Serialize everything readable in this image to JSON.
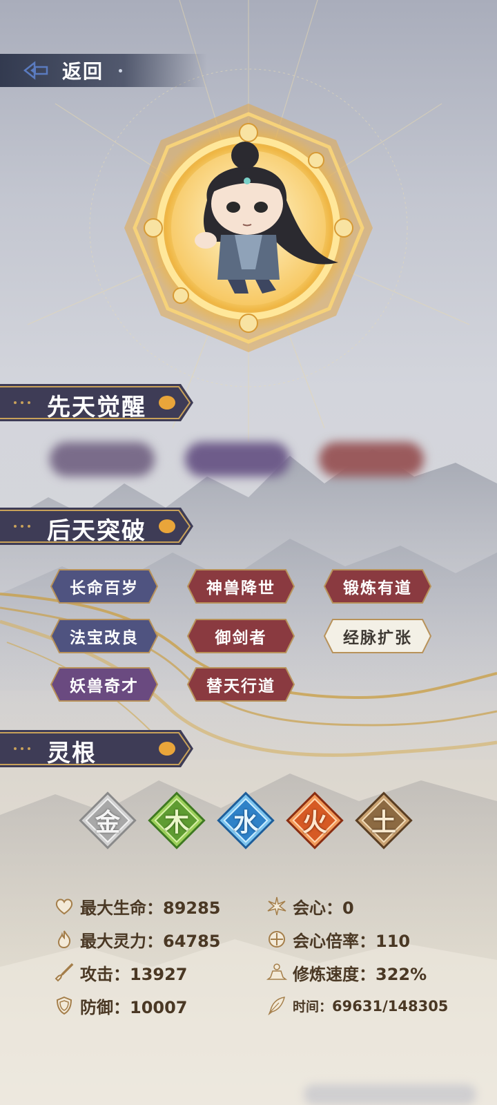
{
  "header": {
    "back_label": "返回"
  },
  "sections": {
    "innate_title": "先天觉醒",
    "acquired_title": "后天突破",
    "spirit_root_title": "灵根"
  },
  "acquired_talents": [
    {
      "label": "长命百岁",
      "color": "#4f5380"
    },
    {
      "label": "神兽降世",
      "color": "#8a3a40"
    },
    {
      "label": "锻炼有道",
      "color": "#8a3a40"
    },
    {
      "label": "法宝改良",
      "color": "#4f5380"
    },
    {
      "label": "御剑者",
      "color": "#8a3a40"
    },
    {
      "label": "经脉扩张",
      "color": "#f3f0e6"
    },
    {
      "label": "妖兽奇才",
      "color": "#6a4a80"
    },
    {
      "label": "替天行道",
      "color": "#8a3a40"
    }
  ],
  "spirit_roots": [
    {
      "char": "金",
      "name": "gold",
      "color": "#b8b8b8"
    },
    {
      "char": "木",
      "name": "wood",
      "color": "#6aa83a"
    },
    {
      "char": "水",
      "name": "water",
      "color": "#3b8fd0"
    },
    {
      "char": "火",
      "name": "fire",
      "color": "#d8602a"
    },
    {
      "char": "土",
      "name": "earth",
      "color": "#a0784a"
    }
  ],
  "stats": {
    "max_hp": "最大生命：89285",
    "max_spirit": "最大灵力：64785",
    "attack": "攻击：13927",
    "defense": "防御：10007",
    "crit": "会心：0",
    "crit_rate": "会心倍率：110",
    "cultivation_speed": "修炼速度：322%",
    "time_label": "时间：",
    "time_value": "69631/148305"
  },
  "colors": {
    "gold": "#e9a53a",
    "header_bg": "#3e3c56",
    "stat_text": "#4a3824"
  }
}
